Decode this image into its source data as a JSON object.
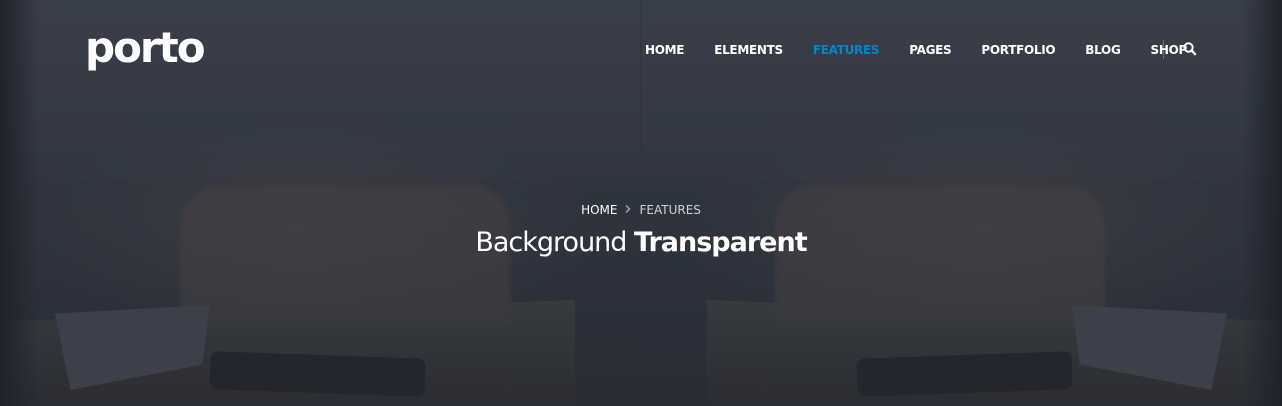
{
  "header": {
    "logo_text": "porto",
    "nav": [
      {
        "label": "HOME",
        "active": false
      },
      {
        "label": "ELEMENTS",
        "active": false
      },
      {
        "label": "FEATURES",
        "active": true
      },
      {
        "label": "PAGES",
        "active": false
      },
      {
        "label": "PORTFOLIO",
        "active": false
      },
      {
        "label": "BLOG",
        "active": false
      },
      {
        "label": "SHOP",
        "active": false
      }
    ],
    "search_icon": "search-icon"
  },
  "page_header": {
    "breadcrumb": {
      "home": "HOME",
      "separator_icon": "chevron-right-icon",
      "current": "FEATURES"
    },
    "title_light": "Background",
    "title_bold": "Transparent"
  },
  "colors": {
    "accent": "#0088cc",
    "text": "#ffffff",
    "overlay": "#20242d"
  }
}
